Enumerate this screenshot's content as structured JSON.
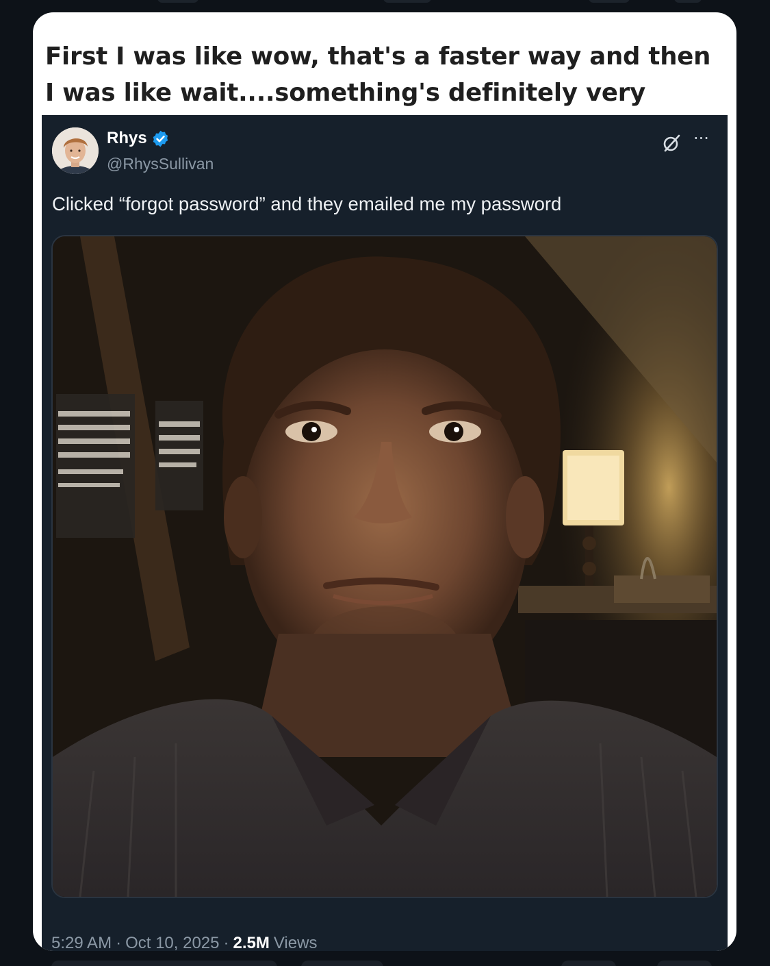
{
  "meme": {
    "caption": "First I was like wow, that's a faster way and then I was like wait....something's definitely very wrong"
  },
  "tweet": {
    "display_name": "Rhys",
    "handle": "@RhysSullivan",
    "text": "Clicked “forgot password” and they emailed me my password",
    "time": "5:29 AM",
    "date": "Oct 10, 2025",
    "separator": "·",
    "views_count": "2.5M",
    "views_label": "Views",
    "more_glyph": "···"
  },
  "icons": {
    "verified": "verified-badge-icon",
    "grok": "grok-icon",
    "more": "more-options-icon"
  },
  "colors": {
    "tweet_bg": "#16202b",
    "verified_blue": "#1d9bf0",
    "secondary_text": "#8b98a5"
  }
}
